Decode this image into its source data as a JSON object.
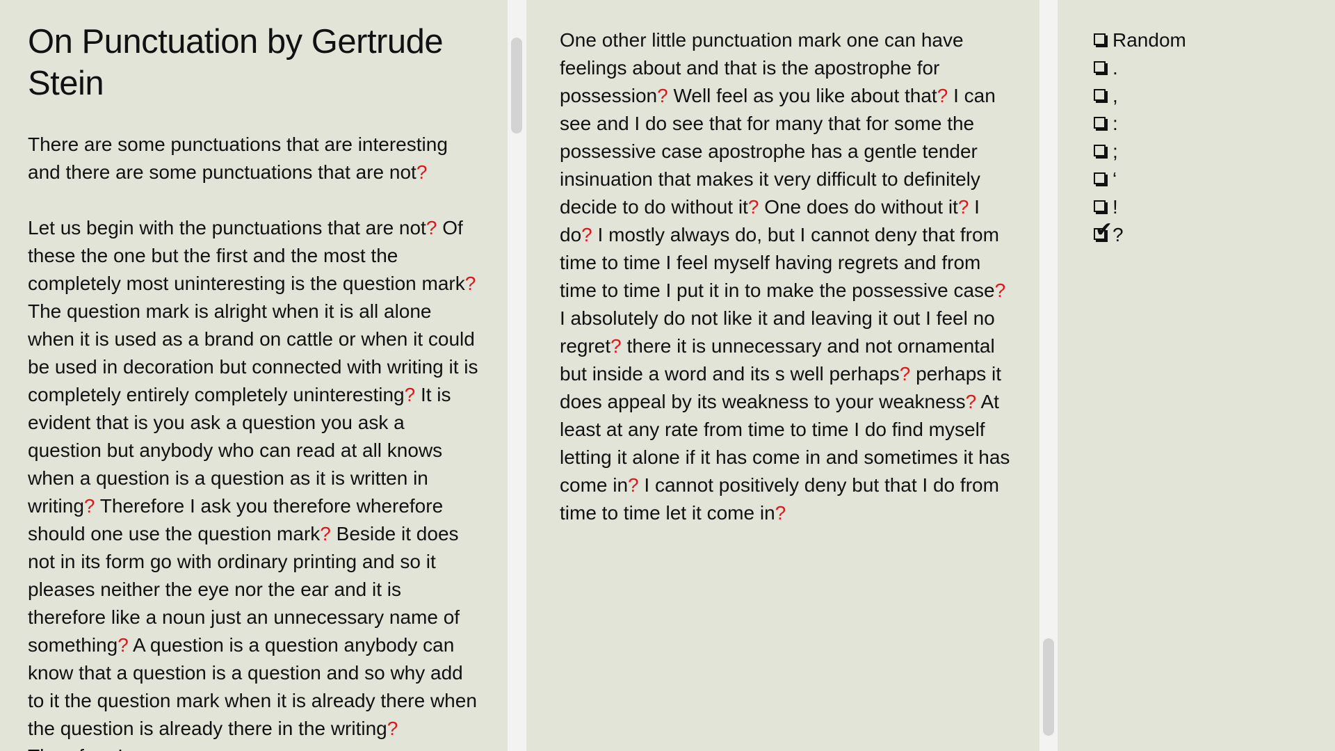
{
  "document": {
    "title": "On Punctuation by Gertrude Stein"
  },
  "left_column": {
    "paragraphs": [
      [
        {
          "t": "There are some punctuations that are interesting and there are some punctuations that are not"
        },
        {
          "t": "?",
          "q": true
        }
      ],
      [
        {
          "t": "Let us begin with the punctuations that are not"
        },
        {
          "t": "?",
          "q": true
        },
        {
          "t": " Of these the one but the first and the most the completely most uninteresting is the question mark"
        },
        {
          "t": "?",
          "q": true
        },
        {
          "t": " The question mark is alright when it is all alone when it is used as a brand on cattle or when it could be used in decoration but connected with writing it is completely entirely completely uninteresting"
        },
        {
          "t": "?",
          "q": true
        },
        {
          "t": " It is evident that is you ask a question you ask a question but anybody who can read at all knows when a question is a question as it is written in writing"
        },
        {
          "t": "?",
          "q": true
        },
        {
          "t": " Therefore I ask you therefore wherefore should one use the question mark"
        },
        {
          "t": "?",
          "q": true
        },
        {
          "t": " Beside it does not in its form go with ordinary printing and so it pleases neither the eye nor the ear and it is therefore like a noun just an unnecessary name of something"
        },
        {
          "t": "?",
          "q": true
        },
        {
          "t": " A question is a question anybody can know that a question is a question and so why add to it the question mark when it is already there when the question is already there in the writing"
        },
        {
          "t": "?",
          "q": true
        },
        {
          "t": " Therefore I never"
        }
      ]
    ]
  },
  "middle_column": {
    "paragraphs": [
      [
        {
          "t": "One other little punctuation mark one can have feelings about and that is the apostrophe for possession"
        },
        {
          "t": "?",
          "q": true
        },
        {
          "t": " Well feel as you like about that"
        },
        {
          "t": "?",
          "q": true
        },
        {
          "t": " I can see and I do see that for many that for some the possessive case apostrophe has a gentle tender insinuation that makes it very difficult to definitely decide to do without it"
        },
        {
          "t": "?",
          "q": true
        },
        {
          "t": " One does do without it"
        },
        {
          "t": "?",
          "q": true
        },
        {
          "t": " I do"
        },
        {
          "t": "?",
          "q": true
        },
        {
          "t": " I mostly always do, but I cannot deny that from time to time I feel myself having regrets and from time to time I put it in to make the possessive case"
        },
        {
          "t": "?",
          "q": true
        },
        {
          "t": " I absolutely do not like it and leaving it out I feel no regret"
        },
        {
          "t": "?",
          "q": true
        },
        {
          "t": " there it is unnecessary and not ornamental but inside a word and its s well perhaps"
        },
        {
          "t": "?",
          "q": true
        },
        {
          "t": " perhaps it does appeal by its weakness to your weakness"
        },
        {
          "t": "?",
          "q": true
        },
        {
          "t": " At least at any rate from time to time I do find myself letting it alone if it has come in and sometimes it has come in"
        },
        {
          "t": "?",
          "q": true
        },
        {
          "t": " I cannot positively deny but that I do from time to time let it come in"
        },
        {
          "t": "?",
          "q": true
        }
      ]
    ]
  },
  "filters": {
    "options": [
      {
        "label": "Random",
        "checked": false,
        "name": "random"
      },
      {
        "label": ".",
        "checked": false,
        "name": "period"
      },
      {
        "label": ",",
        "checked": false,
        "name": "comma"
      },
      {
        "label": ":",
        "checked": false,
        "name": "colon"
      },
      {
        "label": ";",
        "checked": false,
        "name": "semicolon"
      },
      {
        "label": "‘",
        "checked": false,
        "name": "apostrophe"
      },
      {
        "label": "!",
        "checked": false,
        "name": "exclamation"
      },
      {
        "label": "?",
        "checked": true,
        "name": "question"
      }
    ],
    "check_glyph": "✔"
  },
  "colors": {
    "background": "#e2e4d8",
    "gutter": "#f3f3f2",
    "scrollbar_thumb": "#d3d3d3",
    "highlight": "#e0161b",
    "text": "#111111"
  }
}
